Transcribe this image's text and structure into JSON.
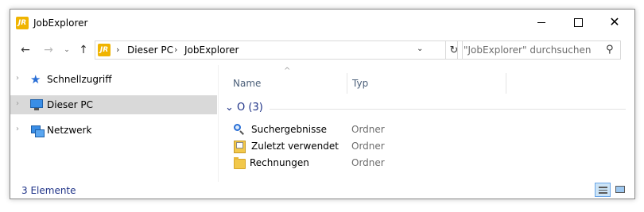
{
  "window": {
    "title": "JobExplorer",
    "app_icon_text": "JR"
  },
  "navigation": {
    "back_glyph": "←",
    "forward_glyph": "→",
    "recent_glyph": "⌄",
    "up_glyph": "↑",
    "breadcrumb": [
      "Dieser PC",
      "JobExplorer"
    ],
    "breadcrumb_separator": "›",
    "address_dropdown_glyph": "⌄",
    "refresh_glyph": "↻"
  },
  "search": {
    "placeholder": "\"JobExplorer\" durchsuchen"
  },
  "sidebar": {
    "items": [
      {
        "label": "Schnellzugriff",
        "icon": "star-icon"
      },
      {
        "label": "Dieser PC",
        "icon": "computer-icon",
        "selected": true
      },
      {
        "label": "Netzwerk",
        "icon": "network-icon"
      }
    ]
  },
  "content": {
    "columns": {
      "name": "Name",
      "type": "Typ"
    },
    "group_label": "O (3)",
    "rows": [
      {
        "name": "Suchergebnisse",
        "type": "Ordner",
        "icon": "search-results-icon"
      },
      {
        "name": "Zuletzt verwendet",
        "type": "Ordner",
        "icon": "recent-folder-icon"
      },
      {
        "name": "Rechnungen",
        "type": "Ordner",
        "icon": "folder-icon"
      }
    ]
  },
  "status": {
    "item_count": "3 Elemente"
  },
  "colors": {
    "accent": "#f0b400",
    "selection": "#d9d9d9",
    "group_text": "#1e3287"
  }
}
